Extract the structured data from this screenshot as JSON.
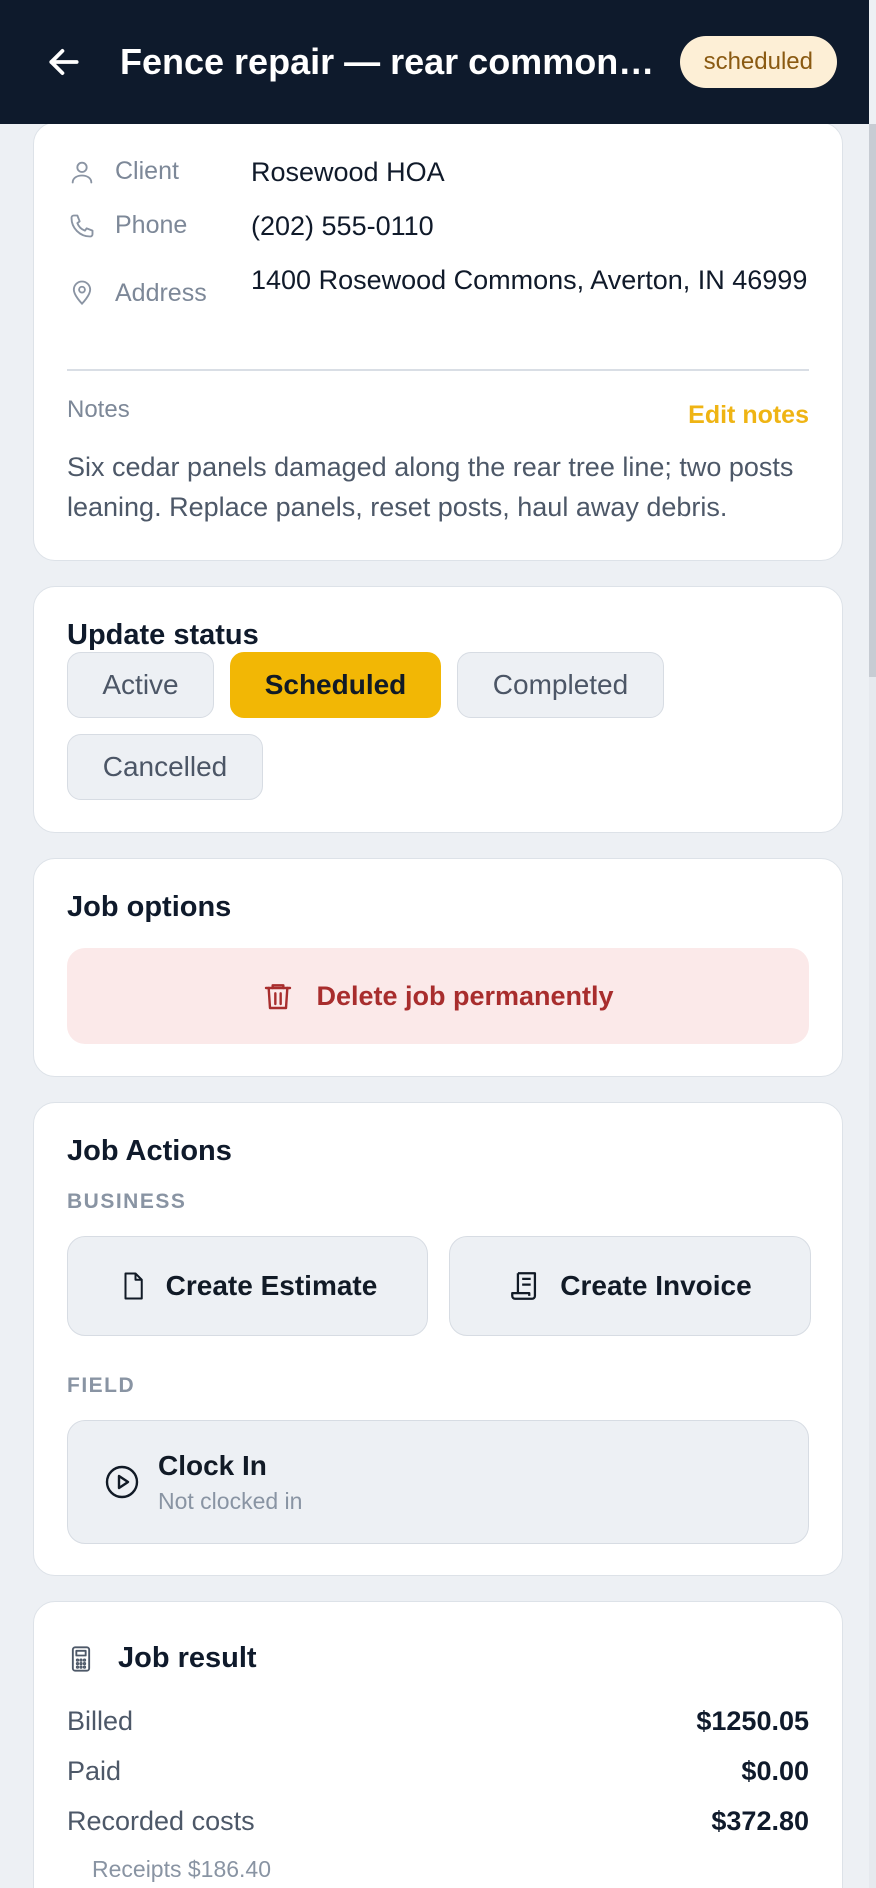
{
  "header": {
    "back_icon": "arrow-left-icon",
    "title": "Fence repair — rear common-area panels",
    "status_badge": "scheduled"
  },
  "details": {
    "client_label": "Client",
    "client_value": "Rosewood HOA",
    "phone_label": "Phone",
    "phone_value": "(202) 555-0110",
    "address_label": "Address",
    "address_value": "1400 Rosewood Commons, Averton, IN 46999",
    "notes_label": "Notes",
    "edit_notes_label": "Edit notes",
    "notes_text": "Six cedar panels damaged along the rear tree line; two posts leaning. Replace panels, reset posts, haul away debris."
  },
  "status_update": {
    "title": "Update status",
    "options": [
      "Active",
      "Scheduled",
      "Completed",
      "Cancelled"
    ],
    "selected": "Scheduled"
  },
  "job_options": {
    "title": "Job options",
    "delete_label": "Delete job permanently"
  },
  "job_actions": {
    "title": "Job Actions",
    "business_label": "BUSINESS",
    "create_estimate_label": "Create Estimate",
    "create_invoice_label": "Create Invoice",
    "field_label": "FIELD",
    "clock_in_label": "Clock In",
    "clock_status": "Not clocked in"
  },
  "job_result": {
    "title": "Job result",
    "billed_label": "Billed",
    "billed_value": "$1250.05",
    "paid_label": "Paid",
    "paid_value": "$0.00",
    "costs_label": "Recorded costs",
    "costs_value": "$372.80",
    "receipts_text": "Receipts $186.40"
  },
  "colors": {
    "header_bg": "#0e1a2c",
    "accent": "#f2b705",
    "danger": "#a82d2d",
    "page_bg": "#edf0f4"
  }
}
